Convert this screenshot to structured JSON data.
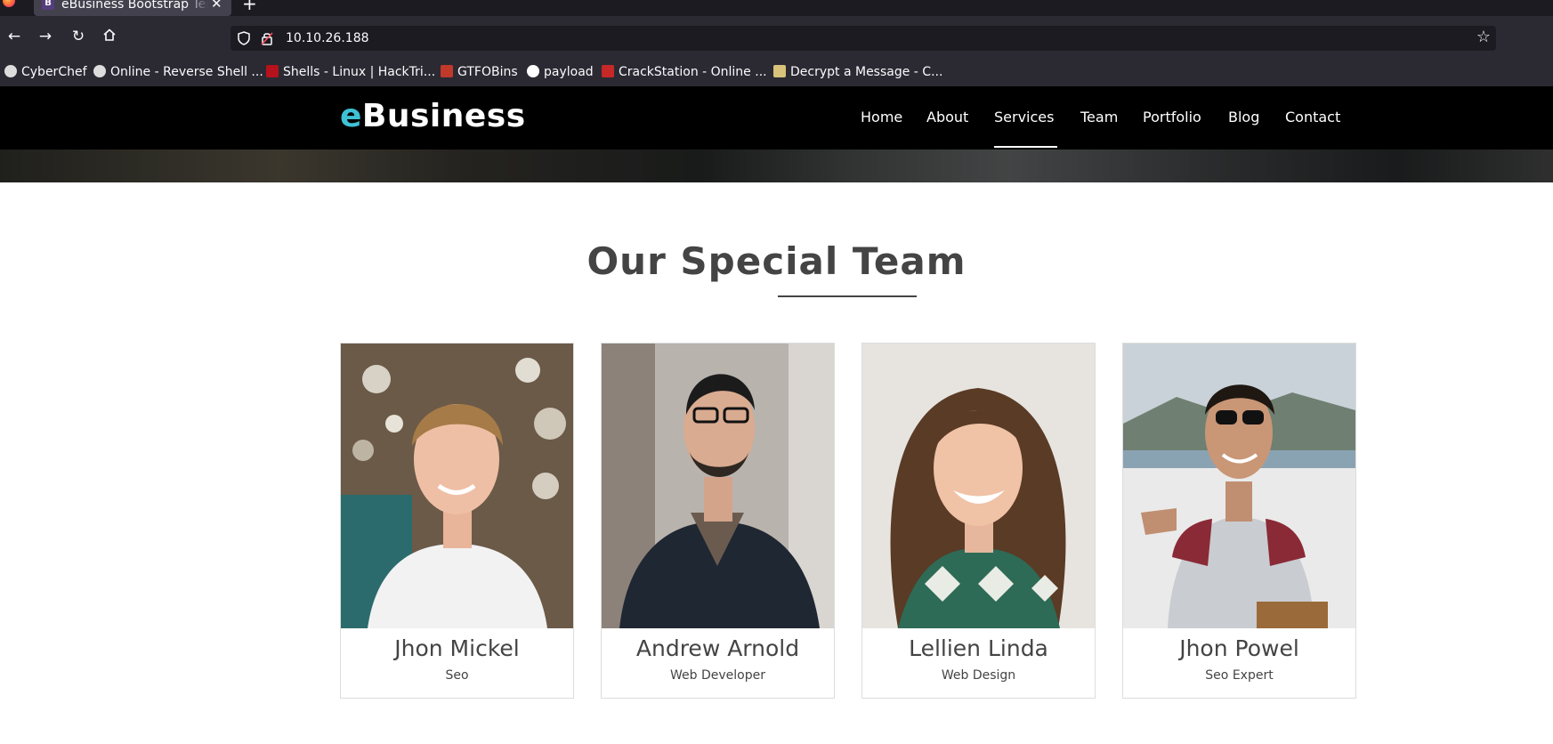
{
  "browser": {
    "tab_title": "eBusiness Bootstrap Tem",
    "tab_favicon": "B",
    "url": "10.10.26.188",
    "bookmarks": [
      {
        "label": "CyberChef",
        "icon": "chef-hat-icon",
        "color": "#dddddd"
      },
      {
        "label": "Online - Reverse Shell ...",
        "icon": "skull-icon",
        "color": "#dddddd"
      },
      {
        "label": "Shells - Linux | HackTri...",
        "icon": "hacktricks-icon",
        "color": "#b5121b"
      },
      {
        "label": "GTFOBins",
        "icon": "gtfobins-icon",
        "color": "#c0392b"
      },
      {
        "label": "payload",
        "icon": "github-icon",
        "color": "#ffffff"
      },
      {
        "label": "CrackStation - Online ...",
        "icon": "crackstation-icon",
        "color": "#c62828"
      },
      {
        "label": "Decrypt a Message - C...",
        "icon": "decrypt-icon",
        "color": "#d9c27a"
      }
    ]
  },
  "site": {
    "brand_accent": "e",
    "brand_rest": "Business",
    "accent_color": "#3ec1d5",
    "menu": [
      "Home",
      "About",
      "Services",
      "Team",
      "Portfolio",
      "Blog",
      "Contact"
    ],
    "active_menu": "Services"
  },
  "team": {
    "title": "Our Special Team",
    "members": [
      {
        "name": "Jhon Mickel",
        "role": "Seo"
      },
      {
        "name": "Andrew Arnold",
        "role": "Web Developer"
      },
      {
        "name": "Lellien Linda",
        "role": "Web Design"
      },
      {
        "name": "Jhon Powel",
        "role": "Seo Expert"
      }
    ]
  }
}
